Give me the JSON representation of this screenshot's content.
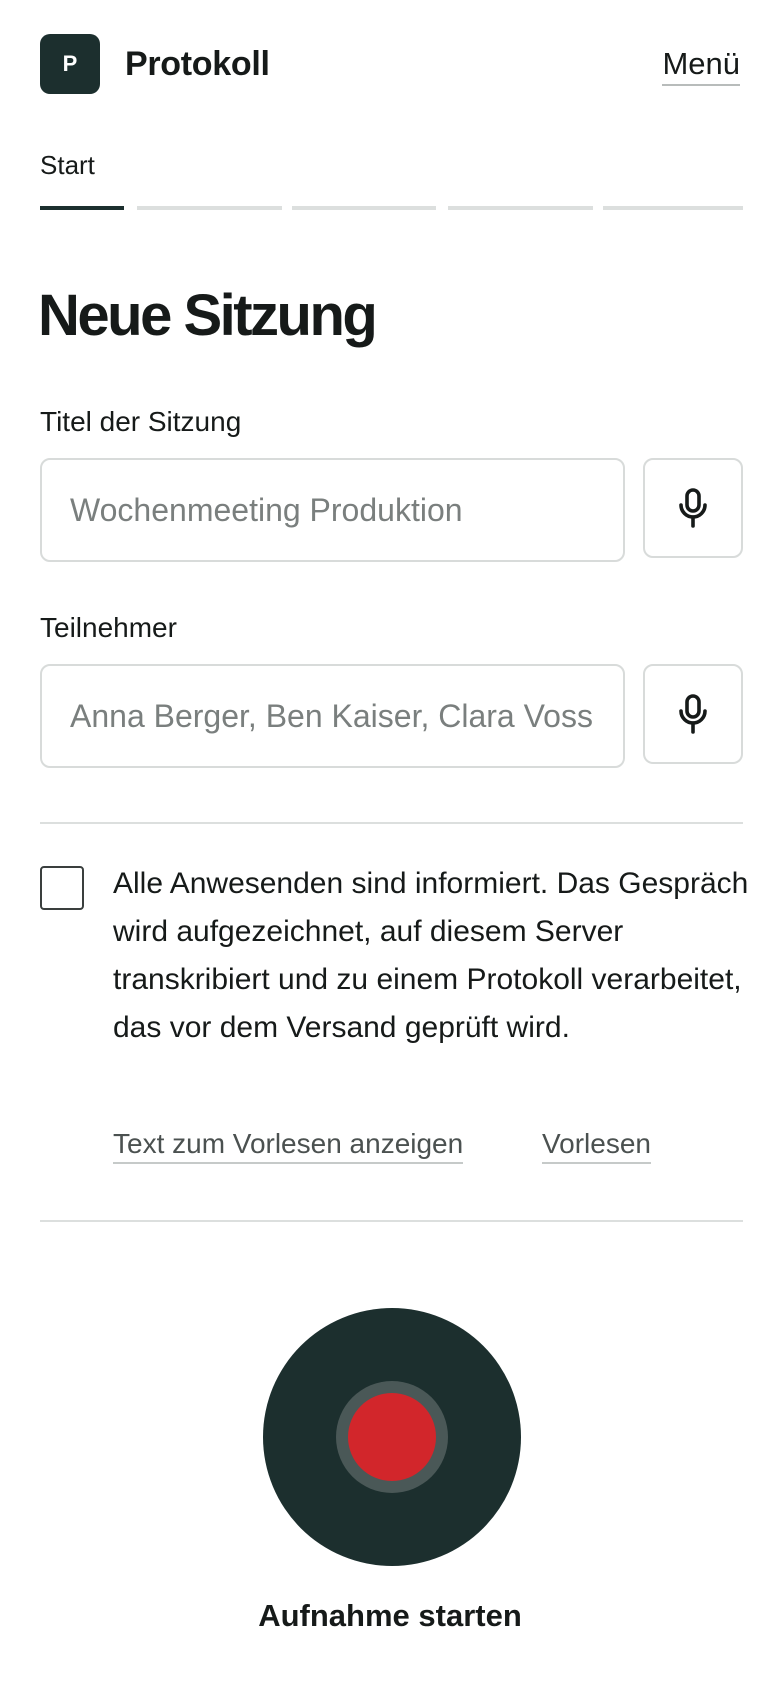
{
  "header": {
    "logo_letter": "P",
    "app_title": "Protokoll",
    "menu_label": "Menü"
  },
  "steps": {
    "current_label": "Start",
    "total": 5,
    "active_index": 0
  },
  "page_title": "Neue Sitzung",
  "form": {
    "title_label": "Titel der Sitzung",
    "title_value": "",
    "title_placeholder": "Wochenmeeting Produktion",
    "participants_label": "Teilnehmer",
    "participants_value": "",
    "participants_placeholder": "Anna Berger, Ben Kaiser, Clara Voss",
    "mic_icon": "microphone-icon"
  },
  "consent": {
    "checked": false,
    "text": "Alle Anwesenden sind informiert. Das Gespräch wird aufgezeichnet, auf diesem Server transkribiert und zu einem Protokoll verarbeitet, das vor dem Versand geprüft wird.",
    "show_text_link": "Text zum Vorlesen anzeigen",
    "read_aloud_link": "Vorlesen"
  },
  "record": {
    "label": "Aufnahme starten",
    "icon": "record-icon"
  },
  "colors": {
    "primary": "#1c2f2e",
    "record": "#d2262b",
    "border": "#d8dbda",
    "text": "#161a19",
    "muted": "#7a7f7e"
  }
}
